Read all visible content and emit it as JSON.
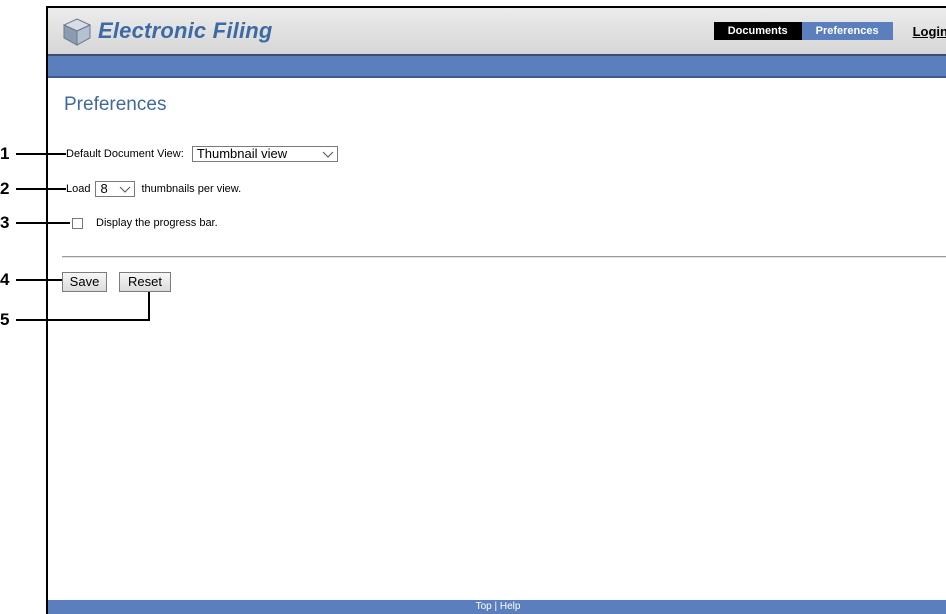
{
  "header": {
    "app_title": "Electronic Filing",
    "nav": {
      "documents": "Documents",
      "preferences": "Preferences",
      "login": "Login"
    }
  },
  "page": {
    "title": "Preferences",
    "default_view_label": "Default Document View:",
    "default_view_value": "Thumbnail view",
    "load_label": "Load",
    "load_value": "8",
    "load_suffix": "thumbnails per view.",
    "progress_label": "Display the progress bar.",
    "progress_checked": false,
    "save_label": "Save",
    "reset_label": "Reset"
  },
  "footer": {
    "top": "Top",
    "separator": " | ",
    "help": "Help"
  },
  "callouts": [
    "1",
    "2",
    "3",
    "4",
    "5"
  ],
  "colors": {
    "accent": "#5b7fbd",
    "title": "#3d6aa5",
    "page_title": "#40699b"
  },
  "icons": {
    "logo": "cube-logo-icon",
    "dropdown": "chevron-down-icon"
  }
}
